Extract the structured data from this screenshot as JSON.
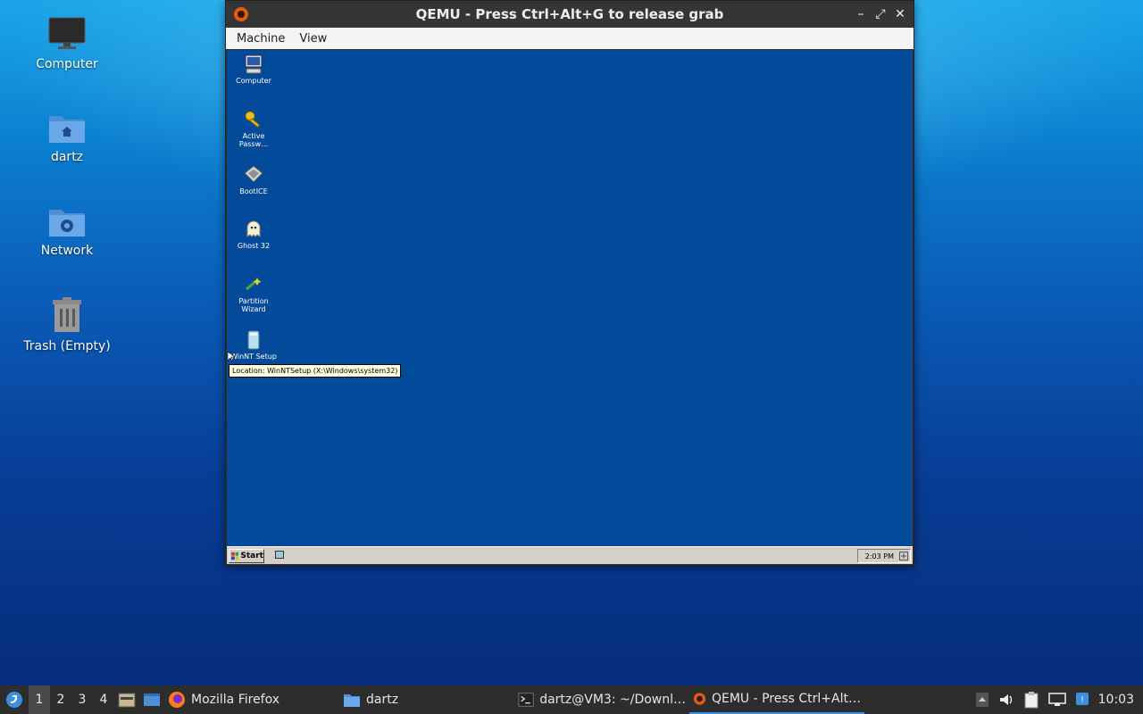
{
  "desktop": {
    "icons": [
      {
        "label": "Computer"
      },
      {
        "label": "dartz"
      },
      {
        "label": "Network"
      },
      {
        "label": "Trash (Empty)"
      }
    ]
  },
  "qemu": {
    "title": "QEMU - Press Ctrl+Alt+G to release grab",
    "menu": [
      "Machine",
      "View"
    ],
    "guest": {
      "icons": [
        {
          "label": "Computer"
        },
        {
          "label": "Active Passw…"
        },
        {
          "label": "BootICE"
        },
        {
          "label": "Ghost 32"
        },
        {
          "label": "Partition Wizard"
        },
        {
          "label": "WinNT Setup"
        }
      ],
      "tooltip": "Location: WinNTSetup (X:\\Windows\\system32)",
      "start_label": "Start",
      "clock": "2:03 PM"
    }
  },
  "taskbar": {
    "workspaces": [
      "1",
      "2",
      "3",
      "4"
    ],
    "tasks": [
      {
        "label": "Mozilla Firefox"
      },
      {
        "label": "dartz"
      },
      {
        "label": "dartz@VM3: ~/Downl…"
      },
      {
        "label": "QEMU - Press Ctrl+Alt…"
      }
    ],
    "clock": "10:03"
  },
  "colors": {
    "guest_desktop": "#034a9a",
    "accent": "#3d8fe0"
  }
}
